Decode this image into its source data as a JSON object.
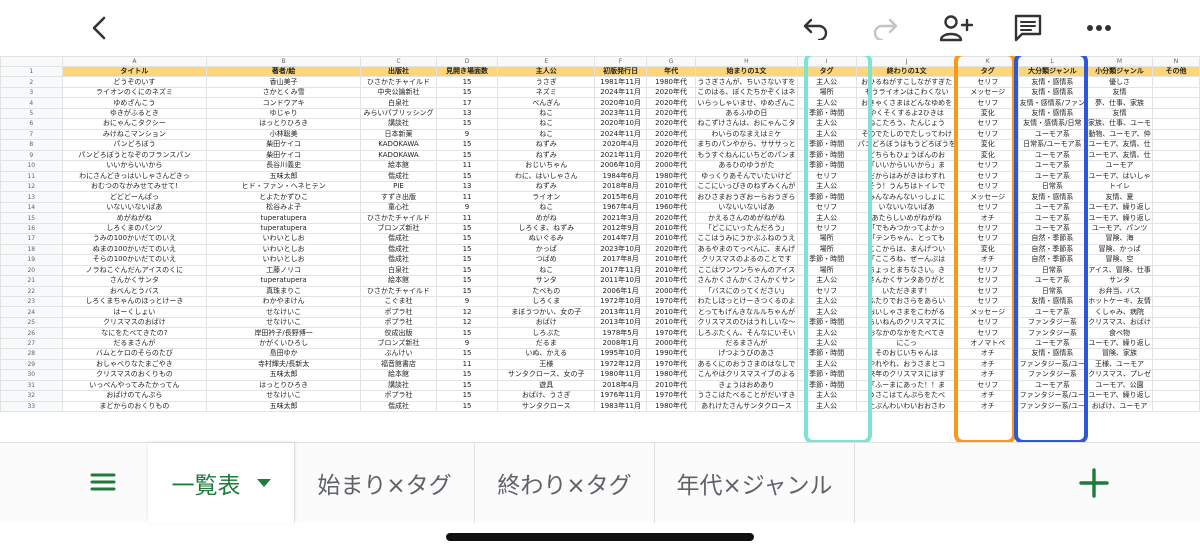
{
  "toolbar": {
    "back_icon": "chevron-left-icon",
    "undo_icon": "undo-icon",
    "redo_icon": "redo-icon",
    "share_icon": "add-person-icon",
    "comment_icon": "comment-icon",
    "more_icon": "more-horizontal-icon"
  },
  "sheet": {
    "column_letters": [
      "A",
      "B",
      "C",
      "D",
      "E",
      "F",
      "G",
      "H",
      "I",
      "J",
      "K",
      "L",
      "M",
      "N"
    ],
    "headers": [
      "タイトル",
      "著者/絵",
      "出版社",
      "見開き場面数",
      "主人公",
      "初版発行日",
      "年代",
      "始まりの1文",
      "タグ",
      "終わりの1文",
      "タグ",
      "大分類ジャンル",
      "小分類ジャンル",
      "その他"
    ],
    "rows": [
      [
        "どうぞのいす",
        "香山美子",
        "ひさかたチャイルド",
        "15",
        "うさぎ",
        "1981年11月",
        "1980年代",
        "うさぎさんが、ちいさないすを",
        "主人公",
        "おひるねがすこしながすぎた",
        "セリフ",
        "友情・感情系",
        "優しさ",
        ""
      ],
      [
        "ライオンのくにのネズミ",
        "さかとくみ雪",
        "中央公論新社",
        "15",
        "ネズミ",
        "2024年11月",
        "2020年代",
        "このはる、ぼくたちかぞくはネ",
        "場所",
        "もうライオンはこわくない",
        "メッセージ",
        "友情・感情系",
        "友情",
        ""
      ],
      [
        "ゆめざんこう",
        "コンドウアキ",
        "白泉社",
        "17",
        "べんぎん",
        "2020年10月",
        "2020年代",
        "いらっしゃいませ、ゆめざんこ",
        "主人公",
        "おきゃくさまはどんなゆめを",
        "セリフ",
        "友情・感情系/ファン",
        "夢、仕事、家族",
        ""
      ],
      [
        "ゆきがふるとき",
        "ゆじゃり",
        "みらいパブリッシング",
        "13",
        "ねこ",
        "2023年11月",
        "2020年代",
        "あるふゆの日",
        "季節・時間",
        "やくそくするよ2ひきは",
        "変化",
        "友情・感情系",
        "友情",
        ""
      ],
      [
        "おにゃんこタクシー",
        "はっとりひろき",
        "講談社",
        "15",
        "ねこ",
        "2020年10月",
        "2020年代",
        "ねこずけさんは、おにゃんこタ",
        "主人公",
        "ねこたろう、たんじょう",
        "セリフ",
        "友情・感情系/日常",
        "家族、仕事、ユーモ",
        ""
      ],
      [
        "みけねこマンション",
        "小林聡美",
        "日本新薬",
        "9",
        "ねこ",
        "2024年11月",
        "2020年代",
        "わいらのなまえはミケ",
        "主人公",
        "そのでたしのでたしってわけ",
        "セリフ",
        "ユーモア系",
        "動物、ユーモア、仲",
        ""
      ],
      [
        "パンどろぼう",
        "柴田ケイコ",
        "KADOKAWA",
        "15",
        "ねずみ",
        "2020年4月",
        "2020年代",
        "まちのパンやから、サササっと",
        "季節・時間",
        "パンどろぼうはもうどろぼうを",
        "変化",
        "日常系/ユーモア系",
        "ユーモア、友情、仕",
        ""
      ],
      [
        "パンどろぼうとなぞのフランスパン",
        "柴田ケイコ",
        "KADOKAWA",
        "15",
        "ねずみ",
        "2021年11月",
        "2020年代",
        "もうすぐねんにいちどのパンま",
        "季節・時間",
        "どちらもひょうばんのお",
        "変化",
        "ユーモア系",
        "ユーモア、友情、仕",
        ""
      ],
      [
        "いいからいいから",
        "長谷川義史",
        "絵本館",
        "11",
        "おじいちゃん",
        "2006年10月",
        "2000年代",
        "あるひのゆうがた",
        "季節・時間",
        "「いいからいいから」ま",
        "セリフ",
        "ユーモア系",
        "ユーモア",
        ""
      ],
      [
        "わにさんどきっはいしゃさんどきっ",
        "五味太郎",
        "偕成社",
        "15",
        "わに、はいしゃさん",
        "1984年6月",
        "1980年代",
        "ゆっくりあそんでいたいけど",
        "セリフ",
        "だからはみがきはわすれ",
        "セリフ",
        "ユーモア系",
        "ユーモア、はいしゃ",
        ""
      ],
      [
        "おむつのなかみせてみせて!",
        "ヒド・ファン・ヘネヒテン",
        "PIE",
        "13",
        "ねずみ",
        "2018年8月",
        "2010年代",
        "ここにいっぴきのねずみくんが",
        "主人公",
        "そう！うんちはトイレで",
        "セリフ",
        "日常系",
        "トイレ",
        ""
      ],
      [
        "どどどーんぱっ",
        "とよたかずひこ",
        "すずき出版",
        "11",
        "ライオン",
        "2015年6月",
        "2010年代",
        "おひさまおうぎおーらおうぎら",
        "季節・時間",
        "みんなみんないっしょに",
        "メッセージ",
        "友情・感情系",
        "友情、夏",
        ""
      ],
      [
        "いないいないばあ",
        "松谷みよ子",
        "童心社",
        "9",
        "ねこ",
        "1967年4月",
        "1960年代",
        "いないいないばあ",
        "セリフ",
        "いないいないばあ",
        "セリフ",
        "ユーモア系",
        "ユーモア、繰り返し",
        ""
      ],
      [
        "めがねがね",
        "tuperatupera",
        "ひさかたチャイルド",
        "11",
        "めがね",
        "2021年3月",
        "2020年代",
        "かえるさんのめがねがね",
        "主人公",
        "あたらしいめがねがね",
        "オチ",
        "ユーモア系",
        "ユーモア、繰り返し",
        ""
      ],
      [
        "しろくまのパンツ",
        "tuperatupera",
        "ブロンズ新社",
        "15",
        "しろくま、ねずみ",
        "2012年9月",
        "2010年代",
        "「どこにいったんだろう」",
        "セリフ",
        "「でもみつかってよかっ",
        "セリフ",
        "ユーモア系",
        "ユーモア、パンツ",
        ""
      ],
      [
        "うみの100かいだてのいえ",
        "いわいとしお",
        "偕成社",
        "15",
        "ぬいぐるみ",
        "2014年7月",
        "2010年代",
        "ここはうみにうかぶふねのうえ",
        "場所",
        "「テンちゃん、とっても",
        "セリフ",
        "自然・季節系",
        "冒険、海",
        ""
      ],
      [
        "ぬまの100かいだてのいえ",
        "いわいとしお",
        "偕成社",
        "15",
        "かっぱ",
        "2023年10月",
        "2020年代",
        "あるやまのてっぺんに、まんげ",
        "場所",
        "ここからは、まんげつい",
        "変化",
        "自然・季節系",
        "冒険、かっぱ",
        ""
      ],
      [
        "そらの100かいだてのいえ",
        "いわいとしお",
        "偕成社",
        "15",
        "つばめ",
        "2017年8月",
        "2010年代",
        "クリスマスのよるのことです",
        "季節・時間",
        "「こころね、ぜーんぶは",
        "オチ",
        "自然・季節系",
        "冒険、空",
        ""
      ],
      [
        "ノラねこぐんだんアイスのくに",
        "工藤ノリコ",
        "白泉社",
        "15",
        "ねこ",
        "2017年11月",
        "2010年代",
        "ここはワンワンちゃんのアイス",
        "場所",
        "ちょっとまちなさい。き",
        "セリフ",
        "日常系",
        "アイス、冒険、仕事",
        ""
      ],
      [
        "さんかくサンタ",
        "tuperatupera",
        "絵本館",
        "15",
        "サンタ",
        "2011年10月",
        "2010年代",
        "さんかくさんかくさんかくサン",
        "主人公",
        "さんかくサンタありがと",
        "セリフ",
        "ユーモア系",
        "サンタ",
        ""
      ],
      [
        "おべんとうバス",
        "真珠まりこ",
        "ひさかたチャイルド",
        "15",
        "たべもの",
        "2006年1月",
        "2000年代",
        "「バスにのってください」",
        "セリフ",
        "いただきます！",
        "セリフ",
        "日常系",
        "お弁当、バス",
        ""
      ],
      [
        "しろくまちゃんのほっとけーき",
        "わかやまけん",
        "こぐま社",
        "9",
        "しろくま",
        "1972年10月",
        "1970年代",
        "わたしほっとけーきつくるのよ",
        "主人公",
        "ふたりでおさらをあらい",
        "セリフ",
        "友情・感情系",
        "ホットケーキ、友情",
        ""
      ],
      [
        "はーくしょい",
        "せなけいこ",
        "ポプラ社",
        "12",
        "まぼうつかい、女の子",
        "2013年11月",
        "2010年代",
        "とってもげんきなルルちゃんが",
        "主人公",
        "おいしゃさまをこわがる",
        "メッセージ",
        "ユーモア系",
        "くしゃみ、病院",
        ""
      ],
      [
        "クリスマスのおばけ",
        "せなけいこ",
        "ポプラ社",
        "12",
        "おばけ",
        "2013年10月",
        "2010年代",
        "クリスマスのひはうれしいな～",
        "季節・時間",
        "らいねんのクリスマスに",
        "セリフ",
        "ファンタジー系",
        "クリスマス、おばけ",
        ""
      ],
      [
        "なにをたべてきたの?",
        "岸田衿子/長野博一",
        "佼成出版",
        "15",
        "しろぶた",
        "1978年5月",
        "1970年代",
        "しろぶたくん、そんなにいそい",
        "主人公",
        "おなかのなかをたべてき",
        "セリフ",
        "ファンタジー系",
        "食べ物",
        ""
      ],
      [
        "だるまさんが",
        "かがくいひろし",
        "ブロンズ新社",
        "9",
        "だるま",
        "2008年1月",
        "2000年代",
        "だるまさんが",
        "主人公",
        "にこっ",
        "オノマトペ",
        "ユーモア系",
        "ユーモア、繰り返し",
        ""
      ],
      [
        "バムとケロのそらのたび",
        "島田ゆか",
        "ぶんけい",
        "15",
        "いぬ、かえる",
        "1995年10月",
        "1990年代",
        "げつようびのあさ",
        "季節・時間",
        "そのおじいちゃんは",
        "オチ",
        "友情・感情系",
        "冒険、家族",
        ""
      ],
      [
        "おしゃべりなたまごやき",
        "寺村輝夫/長新太",
        "福音館書店",
        "11",
        "王様",
        "1972年12月",
        "1970年代",
        "あるくにのおうさまのはなしで",
        "主人公",
        "やれやれ、おうさまとコ",
        "オチ",
        "ファンタジー系/ユー",
        "王様、ユーモア",
        ""
      ],
      [
        "クリスマスのおくりもの",
        "五味太郎",
        "絵本館",
        "15",
        "サンタクロース、女の子",
        "1980年11月",
        "1980年代",
        "こんやはクリスマスイブのよる",
        "季節・時間",
        "来年のクリスマスにはす",
        "オチ",
        "ファンタジー系",
        "クリスマス、プレゼ",
        ""
      ],
      [
        "いっぺんやってみたかってん",
        "はっとりひろき",
        "講談社",
        "15",
        "遊具",
        "2018年4月",
        "2010年代",
        "きょうはおめあり",
        "季節・時間",
        "「ふーまにあった！！ま",
        "セリフ",
        "ユーモア系",
        "ユーモア、公園",
        ""
      ],
      [
        "おばけのてんぷら",
        "せなけいこ",
        "ポプラ社",
        "15",
        "おばけ、うさぎ",
        "1976年11月",
        "1970年代",
        "うさこはたべることがだいすき",
        "主人公",
        "うさこはてんぷらをたべ",
        "オチ",
        "ファンタジー系/ユー",
        "ユーモア、繰り返し",
        ""
      ],
      [
        "まどからのおくりもの",
        "五味太郎",
        "偕成社",
        "15",
        "サンタクロース",
        "1983年11月",
        "1980年代",
        "あれけたさんサンタクロース",
        "主人公",
        "たぶんわいわいおおさわ",
        "オチ",
        "ファンタジー系/ユー",
        "おばけ、ユーモア",
        ""
      ]
    ]
  },
  "tabs": {
    "menu_icon": "sheet-list-icon",
    "items": [
      {
        "label": "一覧表"
      },
      {
        "label": "始まり×タグ"
      },
      {
        "label": "終わり×タグ"
      },
      {
        "label": "年代×ジャンル"
      }
    ],
    "dropdown_icon": "caret-down-icon",
    "add_icon": "plus-icon"
  },
  "colors": {
    "header_fill": "#fcd679",
    "highlight_tag_start": "#7ee3d4",
    "highlight_tag_end": "#f59a1c",
    "highlight_genre": "#2f58d6",
    "tab_active": "#1e7b3c"
  }
}
